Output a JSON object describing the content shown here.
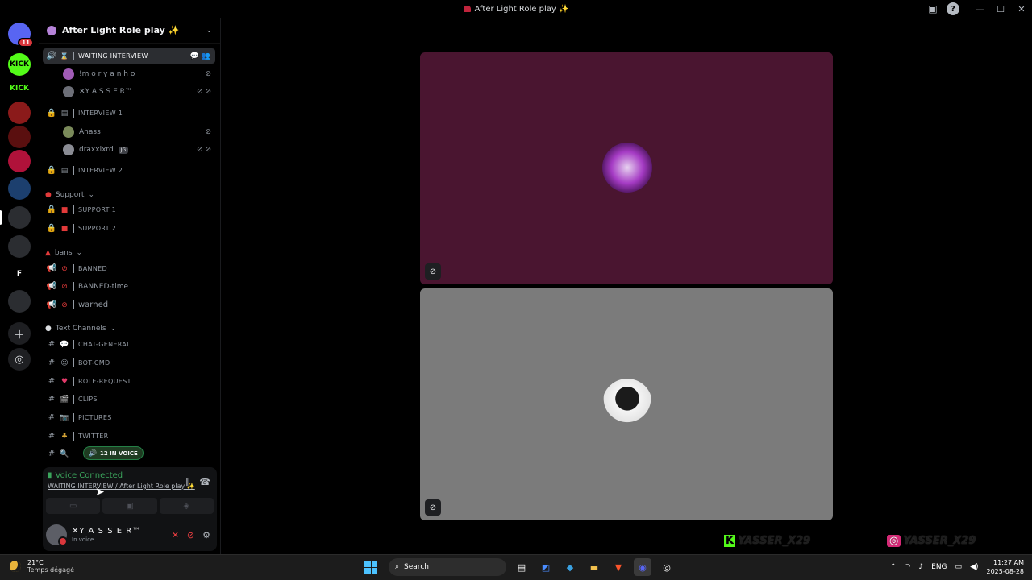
{
  "window": {
    "title": "After Light Role play ✨"
  },
  "servers": [
    {
      "name": "discord-home",
      "label": "",
      "color": "#5865f2",
      "badge": "11"
    },
    {
      "name": "kick-server-1",
      "label": "KICK",
      "color": "#53fc18",
      "badge": ""
    },
    {
      "name": "kick-server-2",
      "label": "KICK",
      "color": "#000000",
      "badge": ""
    },
    {
      "name": "server-red-1",
      "label": "",
      "color": "#8b1a1a",
      "badge": ""
    },
    {
      "name": "server-red-2",
      "label": "",
      "color": "#5a0f0f",
      "badge": ""
    },
    {
      "name": "server-red-3",
      "label": "",
      "color": "#b0123a",
      "badge": ""
    },
    {
      "name": "server-valorant",
      "label": "",
      "color": "#1c3f6e",
      "badge": ""
    },
    {
      "name": "server-folder-1",
      "label": "",
      "color": "#2b2d31",
      "badge": ""
    },
    {
      "name": "server-folder-2",
      "label": "",
      "color": "#2b2d31",
      "badge": ""
    },
    {
      "name": "server-f",
      "label": "F",
      "color": "#000000",
      "badge": ""
    },
    {
      "name": "server-folder-3",
      "label": "",
      "color": "#2b2d31",
      "badge": ""
    }
  ],
  "guild": {
    "name": "After Light Role play ✨"
  },
  "channels": {
    "waiting": "WAITING INTERVIEW",
    "interview1": "INTERVIEW 1",
    "interview2": "INTERVIEW 2",
    "support_cat": "Support",
    "support1": "SUPPORT 1",
    "support2": "SUPPORT 2",
    "bans_cat": "bans",
    "banned": "BANNED",
    "banned_time": "BANNED-time",
    "warned": "warned",
    "text_cat": "Text Channels",
    "chat_general": "CHAT-GENERAL",
    "bot_cmd": "BOT-CMD",
    "role_request": "ROLE-REQUEST",
    "clips": "CLIPS",
    "pictures": "PICTURES",
    "twitter": "TWITTER"
  },
  "voice_users": {
    "u1": "!m o r y a n h o",
    "u2": "✕Y A S S E R™",
    "u3": "Anass",
    "u4": "draxxlxrd",
    "u4_tag": "JG"
  },
  "voice_pill": "12 IN VOICE",
  "panel": {
    "status": "Voice Connected",
    "location": "WAITING INTERVIEW / After Light Role play ✨",
    "username": "✕Y A S S E R™",
    "user_status": "In voice"
  },
  "watermarks": {
    "kick": "YASSER_X29",
    "instagram": "YASSER_X29"
  },
  "taskbar": {
    "temp": "21°C",
    "weather": "Temps dégagé",
    "search_placeholder": "Search",
    "lang": "ENG",
    "time": "11:27 AM",
    "date": "2025-08-28"
  }
}
